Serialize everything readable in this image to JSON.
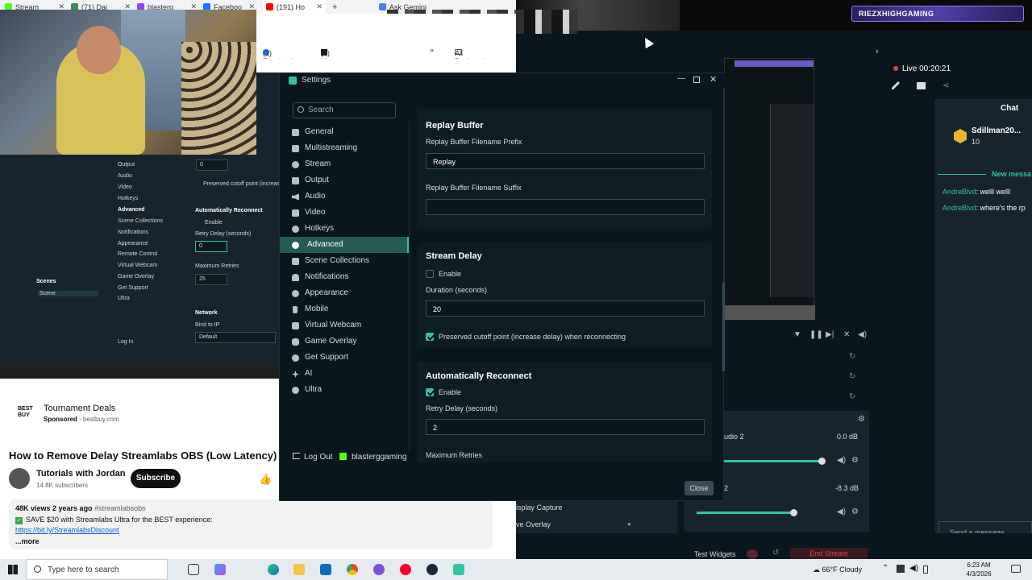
{
  "browser": {
    "tabs": [
      "Stream",
      "(71) Dai",
      "blasterg",
      "Faceboo",
      "(191) Ho",
      "Ask Gemini"
    ],
    "bookmarks": [
      "(1) Facebook",
      "(2) Home / X",
      "All Bookmarks"
    ]
  },
  "mini_obs": {
    "nav": [
      "Output",
      "Audio",
      "Video",
      "Hotkeys",
      "Advanced",
      "Scene Collections",
      "Notifications",
      "Appearance",
      "Remote Control",
      "Virtual Webcam",
      "Game Overlay",
      "Get Support",
      "Ultra"
    ],
    "field_top": "0",
    "preserved": "Preserved cutoff point (increase",
    "auto_reconnect": "Automatically Reconnect",
    "enable": "Enable",
    "retry": "Retry Delay (seconds)",
    "retry_val": "0",
    "max_retries": "Maximum Retries",
    "max_val": "25",
    "network": "Network",
    "bind": "Bind to IP",
    "bind_val": "Default",
    "scenes": "Scenes",
    "scene": "Scene",
    "logout": "Log In"
  },
  "youtube": {
    "ad_title": "Tournament Deals",
    "ad_sponsored": "Sponsored",
    "ad_domain": "bestbuy.com",
    "ad_logo": "BEST BUY",
    "video_title": "How to Remove Delay Streamlabs OBS (Low Latency)",
    "channel": "Tutorials with Jordan",
    "subscribers": "14.8K subscribers",
    "subscribe": "Subscribe",
    "stats": "48K views  2 years ago",
    "hashtag": "#streamlabsobs",
    "promo": "SAVE $20 with Streamlabs Ultra for the BEST experience:",
    "link": "https://bit.ly/StreamlabsDiscount",
    "more": "...more"
  },
  "right_obs": {
    "logo_text": "RIEZXHIGHGAMING",
    "live": "Live 00:20:21",
    "chat_title": "Chat",
    "chat_user": "Sdillman20...",
    "chat_count": "10",
    "new_messages": "New messa",
    "chat_lines": [
      {
        "user": "AndreBlvd",
        "text": ": welll welll"
      },
      {
        "user": "AndreBlvd",
        "text": ": where's the rp"
      }
    ],
    "send_placeholder": "Send a message",
    "mixer": [
      {
        "name": "udio 2",
        "db": "0.0 dB"
      },
      {
        "name": "2",
        "db": "-8.3 dB"
      }
    ],
    "sources": [
      "isplay Capture",
      "ve Overlay"
    ],
    "test_widgets": "Test Widgets",
    "end_stream": "End Stream"
  },
  "settings": {
    "title": "Settings",
    "search_placeholder": "Search",
    "nav": [
      "General",
      "Multistreaming",
      "Stream",
      "Output",
      "Audio",
      "Video",
      "Hotkeys",
      "Advanced",
      "Scene Collections",
      "Notifications",
      "Appearance",
      "Mobile",
      "Virtual Webcam",
      "Game Overlay",
      "Get Support",
      "AI",
      "Ultra"
    ],
    "active_nav": "Advanced",
    "replay": {
      "title": "Replay Buffer",
      "prefix_label": "Replay Buffer Filename Prefix",
      "prefix_value": "Replay",
      "suffix_label": "Replay Buffer Filename Suffix",
      "suffix_value": ""
    },
    "delay": {
      "title": "Stream Delay",
      "enable": "Enable",
      "enabled": false,
      "duration_label": "Duration (seconds)",
      "duration_value": "20",
      "preserve_label": "Preserved cutoff point (increase delay) when reconnecting",
      "preserve": true
    },
    "reconnect": {
      "title": "Automatically Reconnect",
      "enable": "Enable",
      "enabled": true,
      "retry_label": "Retry Delay (seconds)",
      "retry_value": "2",
      "max_label": "Maximum Retries"
    },
    "logout": "Log Out",
    "username": "blasterggaming",
    "close": "Close"
  },
  "taskbar": {
    "search_placeholder": "Type here to search",
    "weather": "66°F  Cloudy",
    "time": "6:23 AM",
    "date": "4/3/2026"
  },
  "colors": {
    "accent": "#31c3a2",
    "active_nav": "#245c52",
    "bg": "#09161d",
    "card": "#0e1c24"
  }
}
